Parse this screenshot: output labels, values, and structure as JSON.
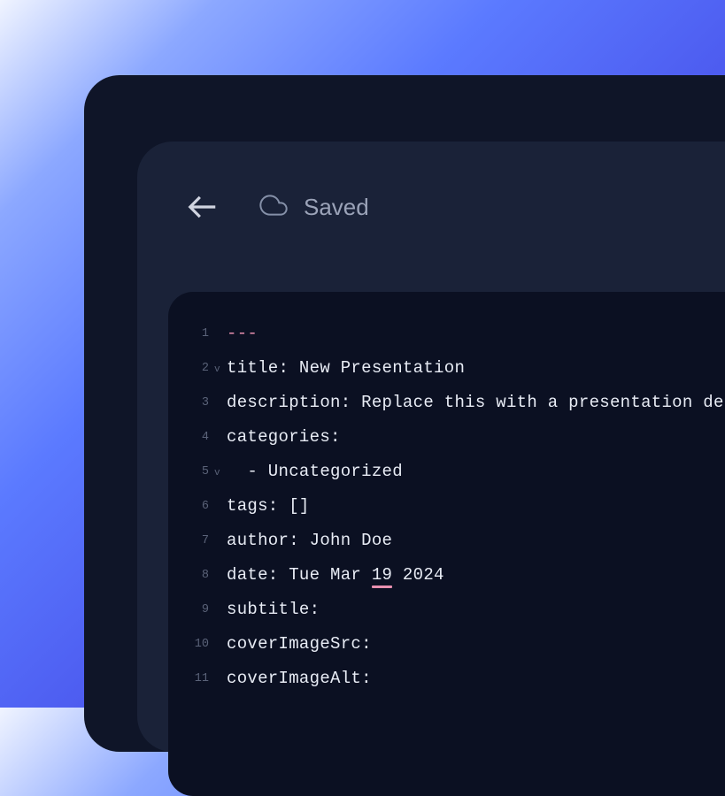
{
  "toolbar": {
    "save_status": "Saved"
  },
  "editor": {
    "lines": [
      {
        "num": "1",
        "fold": "",
        "content": "---",
        "dashes": true
      },
      {
        "num": "2",
        "fold": "v",
        "content": "title: New Presentation"
      },
      {
        "num": "3",
        "fold": "",
        "content": "description: Replace this with a presentation des"
      },
      {
        "num": "4",
        "fold": "",
        "content": "categories:"
      },
      {
        "num": "5",
        "fold": "v",
        "content": "  - Uncategorized"
      },
      {
        "num": "6",
        "fold": "",
        "content": "tags: []"
      },
      {
        "num": "7",
        "fold": "",
        "content": "author: John Doe"
      },
      {
        "num": "8",
        "fold": "",
        "content_pre": "date: Tue Mar ",
        "content_marked": "19",
        "content_post": " 2024",
        "has_marker": true
      },
      {
        "num": "9",
        "fold": "",
        "content": "subtitle:"
      },
      {
        "num": "10",
        "fold": "",
        "content": "coverImageSrc:"
      },
      {
        "num": "11",
        "fold": "",
        "content": "coverImageAlt:"
      }
    ]
  }
}
